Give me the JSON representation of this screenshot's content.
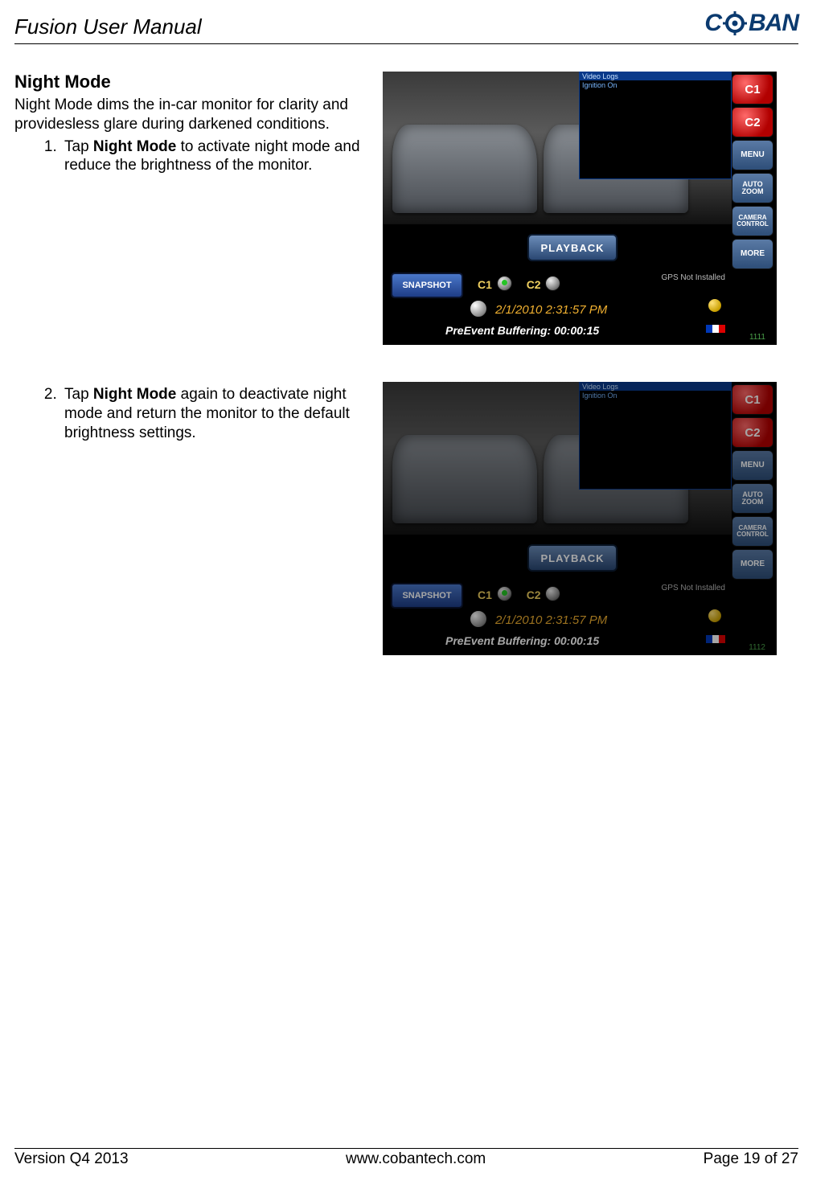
{
  "header": {
    "doc_title": "Fusion User Manual",
    "logo_text": "COBAN"
  },
  "section": {
    "title": "Night Mode",
    "intro": "Night Mode dims the in-car monitor for clarity and providesless glare during darkened conditions.",
    "steps": [
      {
        "n": "1.",
        "pre": "Tap ",
        "bold": "Night Mode",
        "post": " to activate night mode and reduce the brightness of the monitor."
      },
      {
        "n": "2.",
        "pre": "Tap ",
        "bold": "Night Mode",
        "post": " again to deactivate night mode and return the monitor to the default brightness settings."
      }
    ]
  },
  "screenshot": {
    "log_header": "Video Logs",
    "log_line1": "Ignition On",
    "side_buttons": {
      "c1": "C1",
      "c2": "C2",
      "menu": "MENU",
      "auto_zoom": "AUTO ZOOM",
      "camera_control": "CAMERA CONTROL",
      "more": "MORE"
    },
    "playback": "PLAYBACK",
    "snapshot": "SNAPSHOT",
    "c1_label": "C1",
    "c2_label": "C2",
    "gps": "GPS Not Installed",
    "timestamp": "2/1/2010 2:31:57 PM",
    "buffer": "PreEvent Buffering: 00:00:15",
    "num1": "1111",
    "num2": "1112"
  },
  "footer": {
    "version": "Version Q4 2013",
    "url": "www.cobantech.com",
    "page": "Page 19 of 27"
  }
}
